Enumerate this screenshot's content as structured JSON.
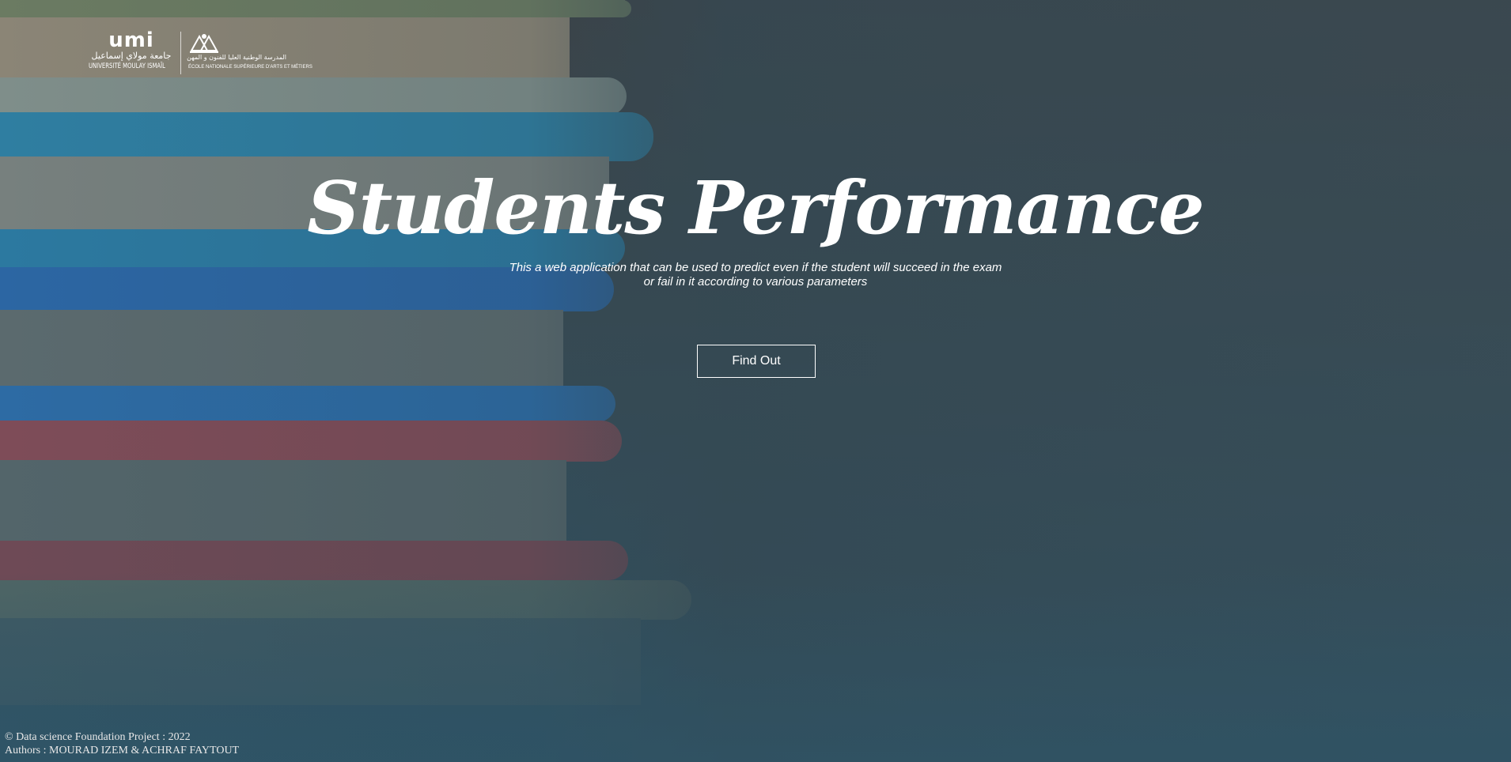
{
  "hero": {
    "title": "Students Performance",
    "subtitle_line1": "This a web application that can be used to predict even if the student will succeed in the exam",
    "subtitle_line2": "or fail in it according to various parameters",
    "cta_label": "Find Out"
  },
  "logo": {
    "umi_mark": "umi",
    "umi_arabic": "جامعة مولاي إسماعيل",
    "umi_latin": "UNIVERSITÉ MOULAY ISMAÏL",
    "ensam_arabic": "المدرسة الوطنية العليا للفنون و المهن",
    "ensam_latin": "ÉCOLE NATIONALE SUPÉRIEURE D'ARTS ET MÉTIERS"
  },
  "footer": {
    "line1": "© Data science Foundation Project : 2022",
    "line2": "Authors : MOURAD IZEM & ACHRAF FAYTOUT"
  },
  "colors": {
    "text": "#ffffff",
    "footer_text": "#e8e8e8",
    "background_top": "#3f4448",
    "background_bottom": "#2f5466"
  },
  "background": {
    "subject": "stack-of-books-photo"
  }
}
